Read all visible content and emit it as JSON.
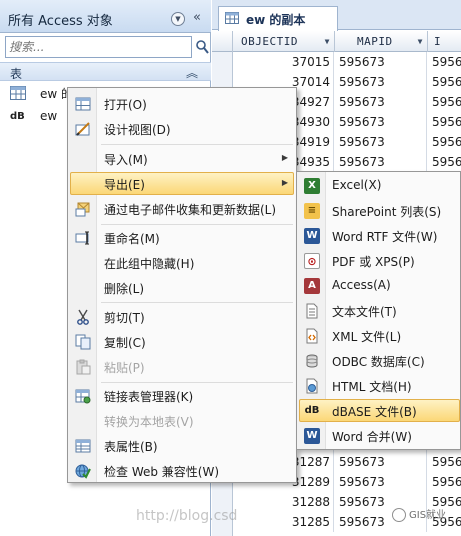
{
  "nav_pane": {
    "title": "所有 Access 对象",
    "search_placeholder": "搜索...",
    "group_label": "表",
    "items": [
      {
        "label": "ew 的副本"
      },
      {
        "label": "ew"
      }
    ]
  },
  "document_tab": {
    "label": "ew 的副本"
  },
  "datasheet": {
    "columns": [
      "OBJECTID",
      "MAPID",
      "I"
    ],
    "rows": [
      {
        "objectid": "37015",
        "mapid": "595673",
        "third": "5956"
      },
      {
        "objectid": "37014",
        "mapid": "595673",
        "third": "5956"
      },
      {
        "objectid": "34927",
        "mapid": "595673",
        "third": "5956"
      },
      {
        "objectid": "34930",
        "mapid": "595673",
        "third": "5956"
      },
      {
        "objectid": "34919",
        "mapid": "595673",
        "third": "5956"
      },
      {
        "objectid": "34935",
        "mapid": "595673",
        "third": "5956"
      },
      {
        "objectid": "",
        "mapid": "",
        "third": ""
      },
      {
        "objectid": "",
        "mapid": "",
        "third": ""
      },
      {
        "objectid": "",
        "mapid": "",
        "third": ""
      },
      {
        "objectid": "",
        "mapid": "",
        "third": ""
      },
      {
        "objectid": "",
        "mapid": "",
        "third": ""
      },
      {
        "objectid": "",
        "mapid": "",
        "third": ""
      },
      {
        "objectid": "",
        "mapid": "",
        "third": ""
      },
      {
        "objectid": "",
        "mapid": "",
        "third": ""
      },
      {
        "objectid": "",
        "mapid": "",
        "third": ""
      },
      {
        "objectid": "",
        "mapid": "",
        "third": ""
      },
      {
        "objectid": "",
        "mapid": "",
        "third": ""
      },
      {
        "objectid": "",
        "mapid": "",
        "third": ""
      },
      {
        "objectid": "",
        "mapid": "",
        "third": ""
      },
      {
        "objectid": "",
        "mapid": "",
        "third": ""
      },
      {
        "objectid": "31287",
        "mapid": "595673",
        "third": "5956"
      },
      {
        "objectid": "31289",
        "mapid": "595673",
        "third": "5956"
      },
      {
        "objectid": "31288",
        "mapid": "595673",
        "third": "5956"
      },
      {
        "objectid": "31285",
        "mapid": "595673",
        "third": "5956"
      }
    ]
  },
  "context_menu": {
    "items": [
      {
        "label": "打开(O)",
        "icon": "open-table-icon"
      },
      {
        "label": "设计视图(D)",
        "icon": "design-view-icon"
      },
      {
        "label": "导入(M)",
        "icon": ""
      },
      {
        "label": "导出(E)",
        "icon": ""
      },
      {
        "label": "通过电子邮件收集和更新数据(L)",
        "icon": "collect-email-icon"
      },
      {
        "label": "重命名(M)",
        "icon": "rename-icon"
      },
      {
        "label": "在此组中隐藏(H)",
        "icon": ""
      },
      {
        "label": "删除(L)",
        "icon": ""
      },
      {
        "label": "剪切(T)",
        "icon": "scissors-icon"
      },
      {
        "label": "复制(C)",
        "icon": "copy-icon"
      },
      {
        "label": "粘贴(P)",
        "icon": "paste-icon"
      },
      {
        "label": "链接表管理器(K)",
        "icon": "linked-table-manager-icon"
      },
      {
        "label": "转换为本地表(V)",
        "icon": ""
      },
      {
        "label": "表属性(B)",
        "icon": "table-properties-icon"
      },
      {
        "label": "检查 Web 兼容性(W)",
        "icon": "web-compat-icon"
      }
    ]
  },
  "export_menu": {
    "items": [
      {
        "label": "Excel(X)",
        "icon": "excel-icon"
      },
      {
        "label": "SharePoint 列表(S)",
        "icon": "sharepoint-icon"
      },
      {
        "label": "Word RTF 文件(W)",
        "icon": "word-rtf-icon"
      },
      {
        "label": "PDF 或 XPS(P)",
        "icon": "pdf-icon"
      },
      {
        "label": "Access(A)",
        "icon": "access-icon"
      },
      {
        "label": "文本文件(T)",
        "icon": "text-file-icon"
      },
      {
        "label": "XML 文件(L)",
        "icon": "xml-file-icon"
      },
      {
        "label": "ODBC 数据库(C)",
        "icon": "odbc-icon"
      },
      {
        "label": "HTML 文档(H)",
        "icon": "html-icon"
      },
      {
        "label": "dBASE 文件(B)",
        "icon": "dbase-icon"
      },
      {
        "label": "Word 合并(W)",
        "icon": "word-merge-icon"
      }
    ]
  },
  "watermark": {
    "url": "http://blog.csd",
    "badge": "GIS就业"
  },
  "colors": {
    "highlight_top": "#fef2c4",
    "highlight_bottom": "#fbd777",
    "selected_row": "#fbeaab",
    "nav_header": "#c9dbf1",
    "border": "#9fb4cf"
  }
}
